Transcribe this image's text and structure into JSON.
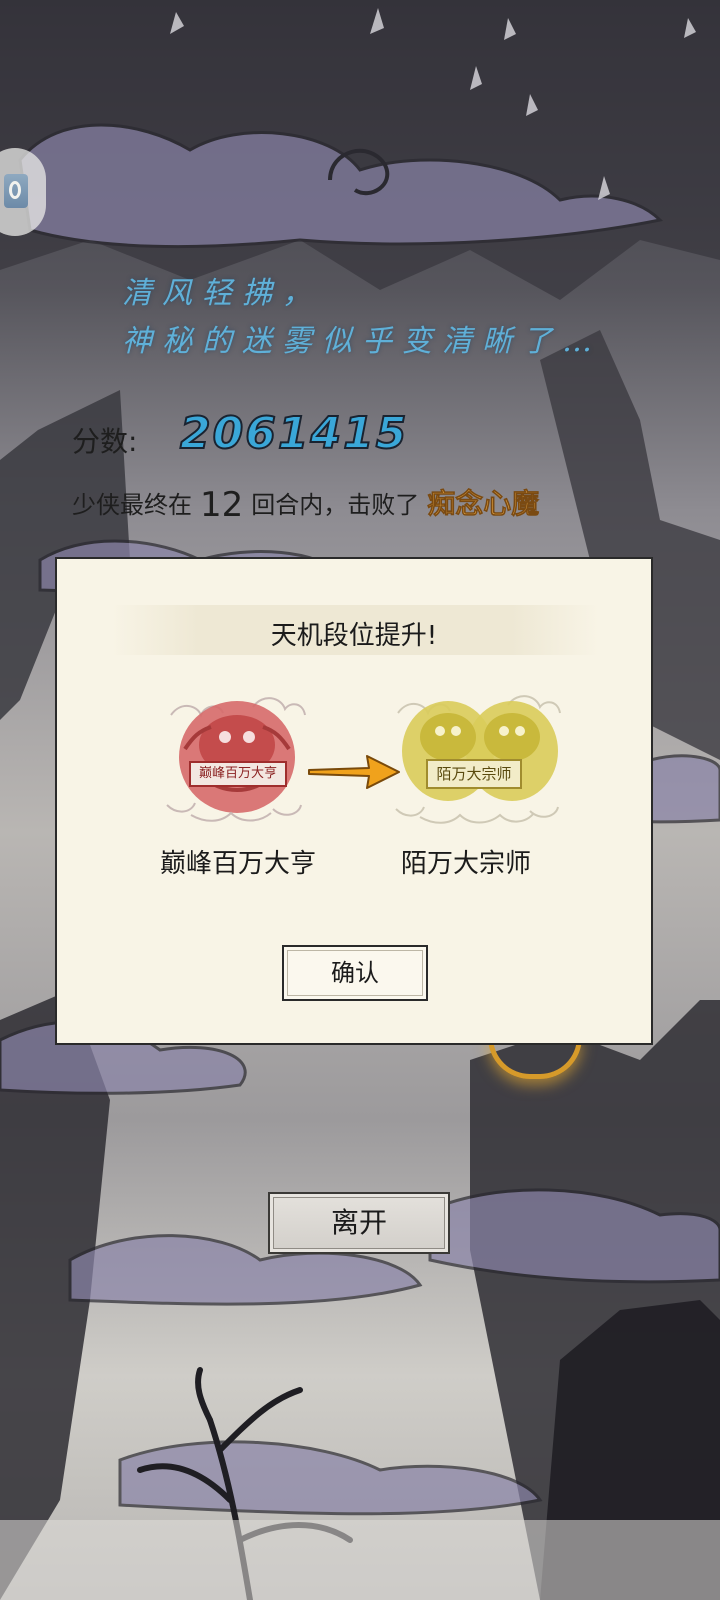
{
  "poem": {
    "line1": "清风轻拂，",
    "line2": "神秘的迷雾似乎变清晰了…"
  },
  "score": {
    "label": "分数:",
    "value": "2061415"
  },
  "result": {
    "prefix": "少侠最终在",
    "rounds": "12",
    "middle": "回合内，击败了",
    "boss": "痴念心魔"
  },
  "rank_up_dialog": {
    "title": "天机段位提升!",
    "from_rank": {
      "plaque": "巅峰百万大亨",
      "name": "巅峰百万大亨",
      "color": "#c84a4a"
    },
    "to_rank": {
      "plaque": "陌万大宗师",
      "name": "陌万大宗师",
      "color": "#d8c64a"
    },
    "arrow_color": "#f0a21c",
    "confirm_label": "确认"
  },
  "leave_button": {
    "label": "离开"
  },
  "colors": {
    "score": "#3aa7d8",
    "boss": "#e5a442",
    "poem": "#5fb0d8",
    "dialog_bg": "#f8f4e6"
  }
}
